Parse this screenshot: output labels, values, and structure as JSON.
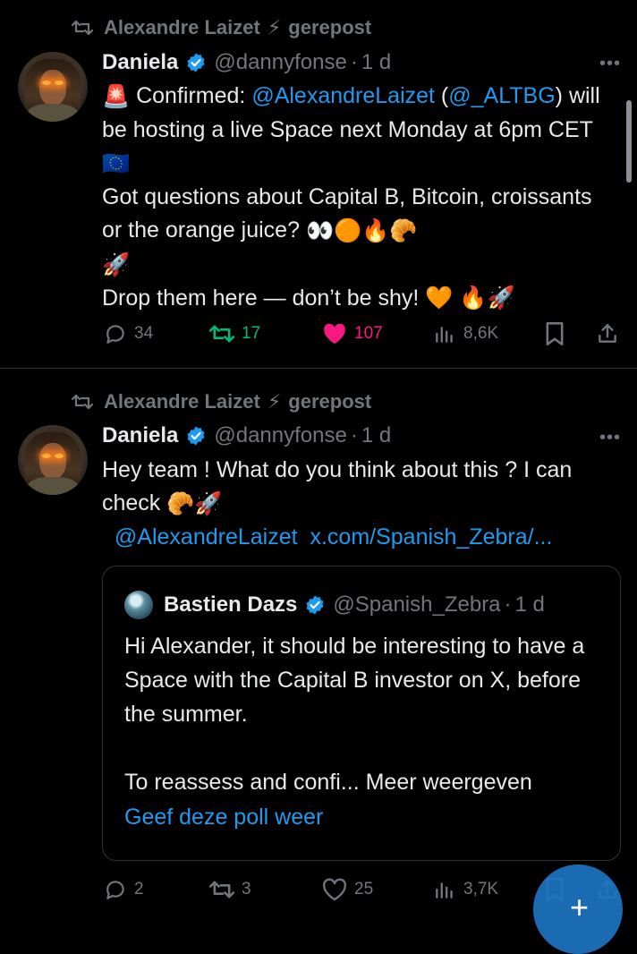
{
  "tweets": [
    {
      "repost_user": "Alexandre Laizet",
      "repost_bolt": "⚡",
      "repost_label": "gerepost",
      "author": "Daniela",
      "handle": "@dannyfonse",
      "time": "1 d",
      "text": {
        "siren": "🚨",
        "p1": " Confirmed: ",
        "mention1": "@AlexandreLaizet",
        "p2": " (",
        "mention2": "@_ALTBG",
        "p3": ") will be hosting a live Space next Monday at 6pm CET ",
        "flag": "🇪🇺",
        "p4": "Got questions about Capital B, Bitcoin, croissants or the orange juice? ",
        "emojis1": "👀🟠🔥🥐",
        "emojis2": "🚀",
        "p5": "Drop them here — don’t be shy! ",
        "emojis3": "🧡 🔥🚀"
      },
      "actions": {
        "replies": "34",
        "reposts": "17",
        "likes": "107",
        "views": "8,6K"
      }
    },
    {
      "repost_user": "Alexandre Laizet",
      "repost_bolt": "⚡",
      "repost_label": "gerepost",
      "author": "Daniela",
      "handle": "@dannyfonse",
      "time": "1 d",
      "text": {
        "p1": "Hey team ! What do you think about this ?  I can check ",
        "emojis": "🥐🚀",
        "mention": "@AlexandreLaizet",
        "url": "x.com/Spanish_Zebra/..."
      },
      "quote": {
        "author": "Bastien Dazs",
        "handle": "@Spanish_Zebra",
        "time": "1 d",
        "text": "Hi Alexander, it should be interesting to have a Space with the Capital B investor on X, before the summer.",
        "text2": "To reassess and confi...",
        "more": "Meer weergeven",
        "poll": "Geef deze poll weer"
      },
      "actions": {
        "replies": "2",
        "reposts": "3",
        "likes": "25",
        "views": "3,7K"
      }
    }
  ],
  "colors": {
    "accent": "#1d9bf0",
    "repost": "#00ba7c",
    "like": "#f91880",
    "muted": "#71767b"
  }
}
